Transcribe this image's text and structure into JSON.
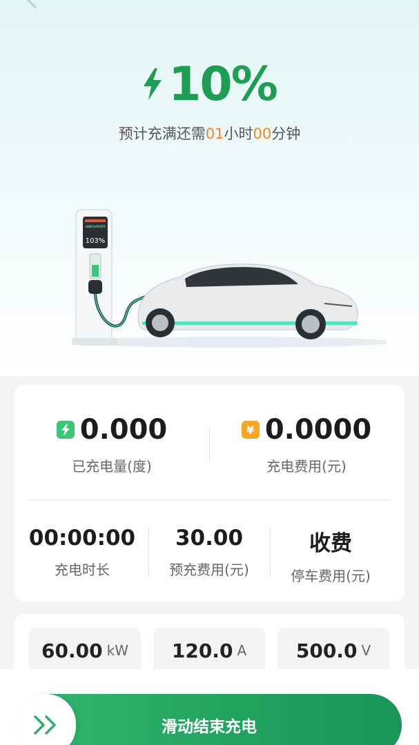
{
  "status": {
    "percent": "10%",
    "eta_prefix": "预计充满还需",
    "eta_hours": "01",
    "eta_hours_unit": "小时",
    "eta_minutes": "00",
    "eta_minutes_unit": "分钟"
  },
  "charger_display": {
    "level_text": "103%",
    "header_text": "LINKCHARGER"
  },
  "summary": {
    "energy": {
      "value": "0.000",
      "label": "已充电量(度)",
      "icon": "bolt-icon"
    },
    "cost": {
      "value": "0.0000",
      "label": "充电费用(元)",
      "icon": "yen-icon",
      "symbol": "¥"
    },
    "duration": {
      "value": "00:00:00",
      "label": "充电时长"
    },
    "prepaid": {
      "value": "30.00",
      "label": "预充费用(元)"
    },
    "parking": {
      "value": "收费",
      "label": "停车费用(元)"
    }
  },
  "metrics": [
    {
      "value": "60.00",
      "unit": "kW"
    },
    {
      "value": "120.0",
      "unit": "A"
    },
    {
      "value": "500.0",
      "unit": "V"
    }
  ],
  "action": {
    "slide_label": "滑动结束充电",
    "knob_icon": "double-chevron-right-icon"
  },
  "colors": {
    "accent": "#1f9d55",
    "highlight": "#f0882b",
    "badge_orange": "#f5a623"
  }
}
